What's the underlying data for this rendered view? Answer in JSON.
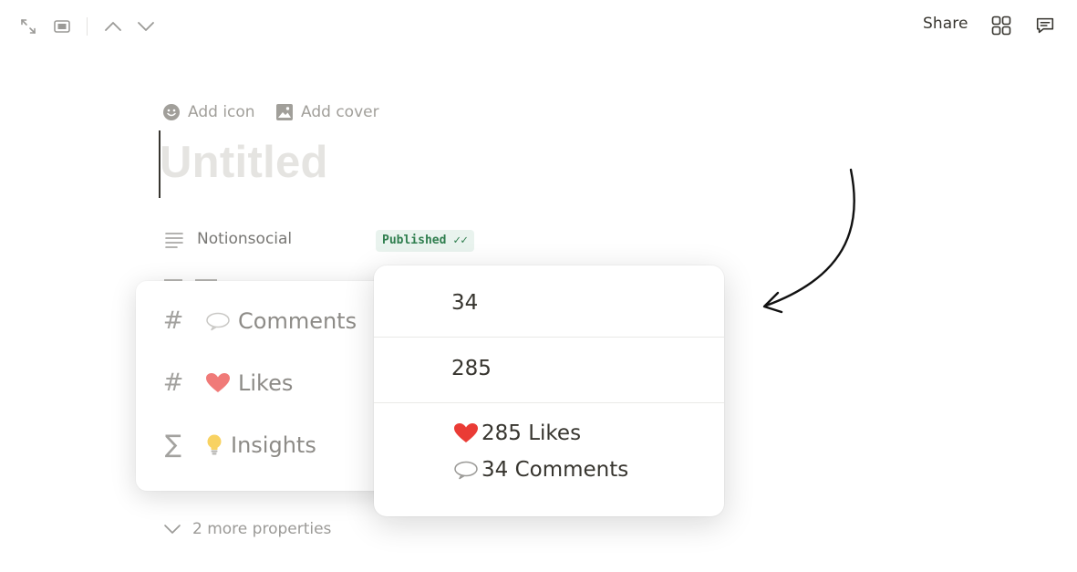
{
  "topbar": {
    "share_label": "Share",
    "icons": [
      "expand-icon",
      "side-peek-icon",
      "chevron-up-icon",
      "chevron-down-icon",
      "layout-icon",
      "comment-icon"
    ]
  },
  "page": {
    "add_icon_label": "Add icon",
    "add_cover_label": "Add cover",
    "title_placeholder": "Untitled"
  },
  "properties": {
    "primary": {
      "icon": "text-lines-icon",
      "label": "Notionsocial",
      "status_badge": "Published ✓✓"
    },
    "panel_labels": [
      {
        "type_icon": "#",
        "emoji": "speech-bubble-icon",
        "label": "Comments"
      },
      {
        "type_icon": "#",
        "emoji": "heart-icon",
        "label": "Likes"
      },
      {
        "type_icon": "∑",
        "emoji": "lightbulb-icon",
        "label": "Insights"
      }
    ],
    "values": {
      "comments": "34",
      "likes": "285",
      "insights_line1": "285 Likes",
      "insights_line2": "34 Comments"
    },
    "more_label": "2 more properties"
  },
  "colors": {
    "badge_bg": "#e9f3ee",
    "badge_text": "#2f7e4e",
    "heart": "#ea3b35",
    "title_placeholder": "#e5e4e1"
  }
}
